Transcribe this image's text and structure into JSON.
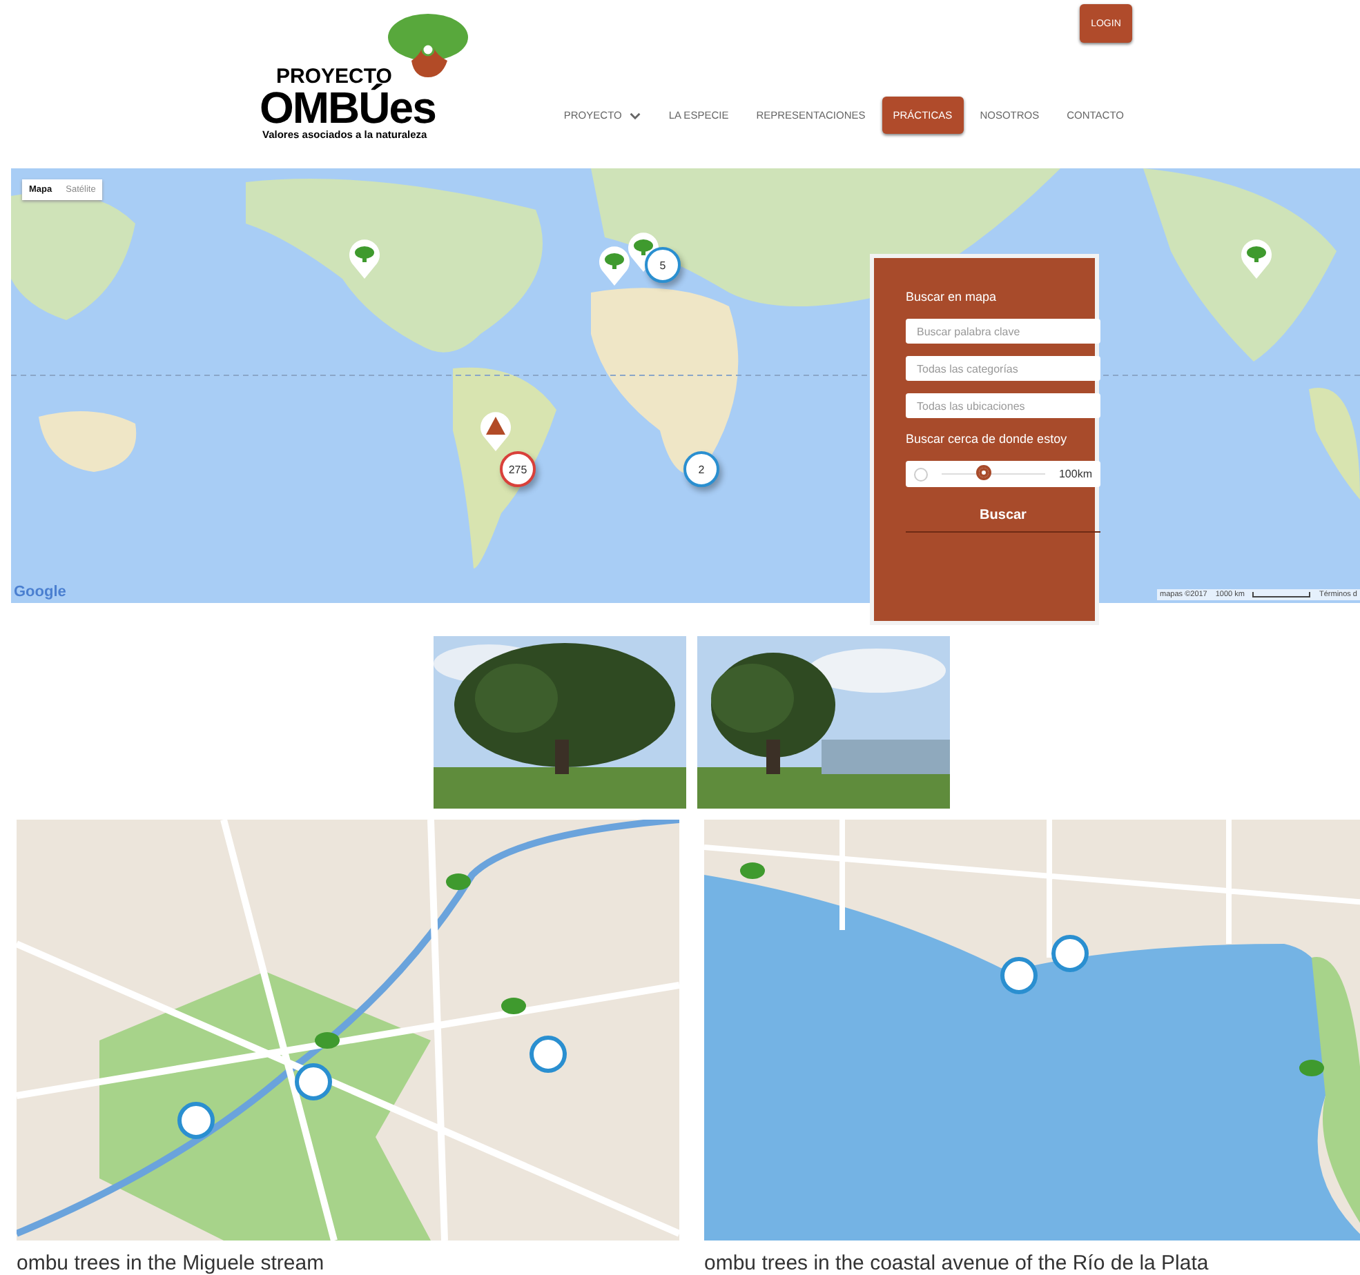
{
  "header": {
    "logo": {
      "top": "PROYECTO",
      "name": "OMBÚes",
      "tagline": "Valores asociados a la naturaleza"
    },
    "login": "LOGIN",
    "nav": [
      {
        "label": "PROYECTO",
        "has_menu": true,
        "selected": false
      },
      {
        "label": "LA ESPECIE",
        "has_menu": false,
        "selected": false
      },
      {
        "label": "REPRESENTACIONES",
        "has_menu": false,
        "selected": false
      },
      {
        "label": "PRÁCTICAS",
        "has_menu": false,
        "selected": true
      },
      {
        "label": "NOSOTROS",
        "has_menu": false,
        "selected": false
      },
      {
        "label": "CONTACTO",
        "has_menu": false,
        "selected": false
      }
    ]
  },
  "world_map": {
    "map_types": [
      {
        "label": "Mapa",
        "selected": true
      },
      {
        "label": "Satélite",
        "selected": false
      }
    ],
    "clusters": [
      {
        "count": "5",
        "color": "#2a8fd0"
      },
      {
        "count": "275",
        "color": "#d9403a"
      },
      {
        "count": "2",
        "color": "#2a8fd0"
      }
    ],
    "logo": "Google",
    "attribution": "mapas ©2017",
    "scale": "1000 km",
    "terms": "Términos d",
    "search_panel": {
      "title": "Buscar en mapa",
      "fields": [
        {
          "placeholder": "Buscar palabra clave"
        },
        {
          "placeholder": "Todas las categorías"
        },
        {
          "placeholder": "Todas las ubicaciones"
        }
      ],
      "nearby_label": "Buscar cerca de donde estoy",
      "radius": {
        "level": 0.4,
        "reading": "100km"
      },
      "button": "Buscar"
    }
  },
  "maps": [
    {
      "kind": "picture",
      "caption": "ombu trees in the Miguele stream"
    },
    {
      "kind": "picture",
      "caption": "ombu trees in the coastal avenue of the Río de la Plata"
    }
  ]
}
